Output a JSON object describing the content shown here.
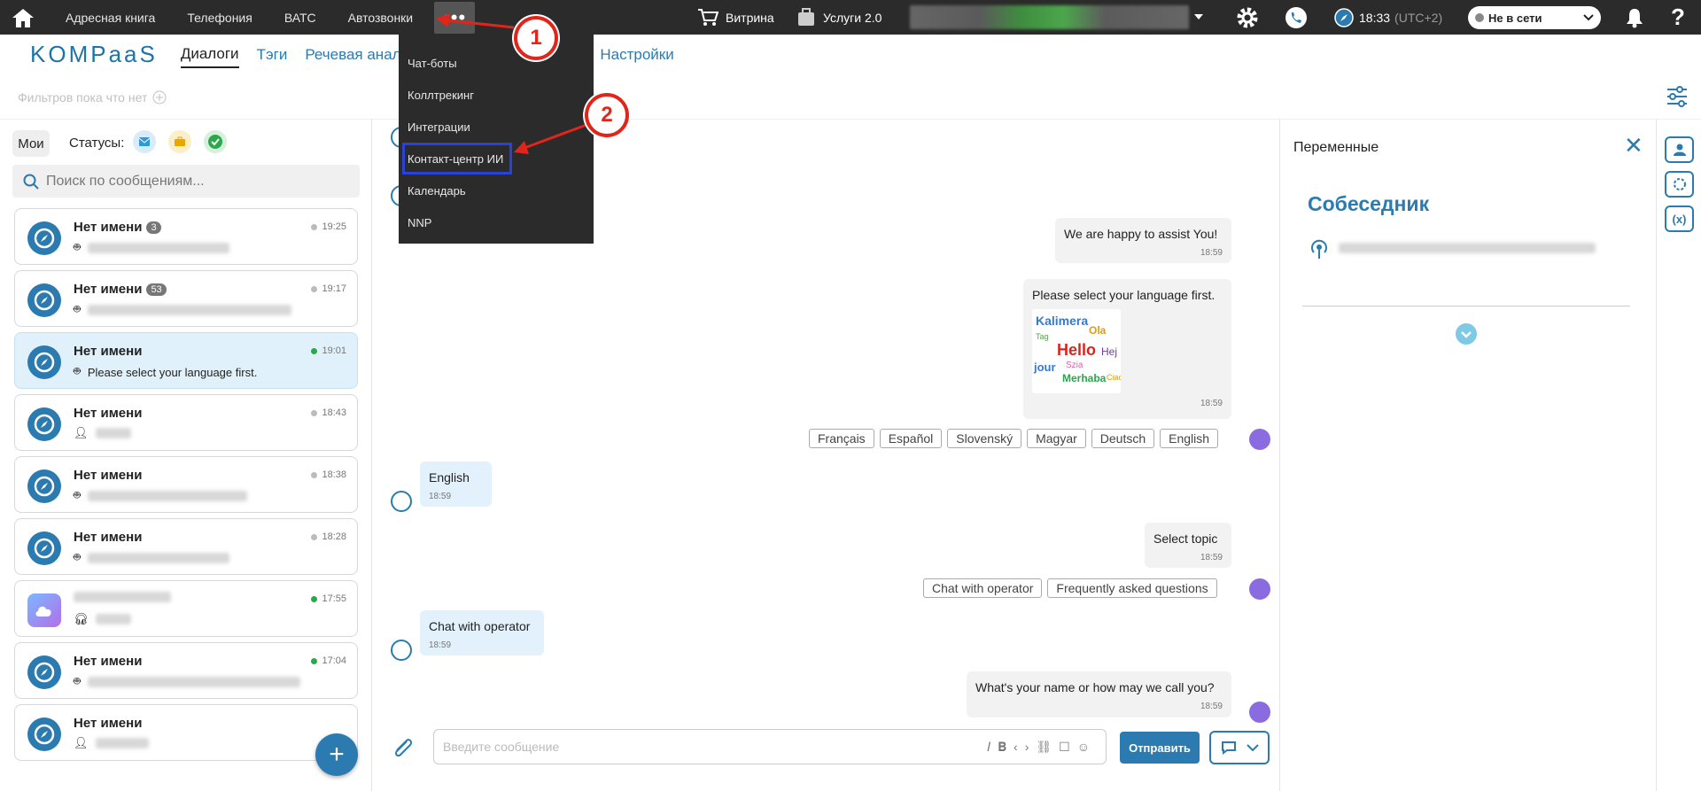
{
  "topbar": {
    "nav": [
      "Адресная книга",
      "Телефония",
      "ВАТС",
      "Автозвонки"
    ],
    "more_label": "•••",
    "showcase": "Витрина",
    "services": "Услуги 2.0",
    "clock": "18:33",
    "timezone": "(UTC+2)",
    "status": "Не в сети",
    "help": "?"
  },
  "header": {
    "logo": "KOMPaaS",
    "tabs": [
      "Диалоги",
      "Тэги",
      "Речевая аналити",
      "Настройки"
    ]
  },
  "filters": {
    "empty_text": "Фильтров пока что нет"
  },
  "sidebar": {
    "mine_label": "Мои",
    "statuses_label": "Статусы:",
    "search_placeholder": "Поиск по сообщениям...",
    "chats": [
      {
        "name": "Нет имени",
        "badge": "3",
        "time": "19:25",
        "status": "gray",
        "message": ""
      },
      {
        "name": "Нет имени",
        "badge": "53",
        "time": "19:17",
        "status": "gray",
        "message": ""
      },
      {
        "name": "Нет имени",
        "badge": "",
        "time": "19:01",
        "status": "green",
        "message": "Please select your language first."
      },
      {
        "name": "Нет имени",
        "badge": "",
        "time": "18:43",
        "status": "gray",
        "message": ""
      },
      {
        "name": "Нет имени",
        "badge": "",
        "time": "18:38",
        "status": "gray",
        "message": ""
      },
      {
        "name": "Нет имени",
        "badge": "",
        "time": "18:28",
        "status": "gray",
        "message": ""
      },
      {
        "name": "",
        "badge": "",
        "time": "17:55",
        "status": "green",
        "message": ""
      },
      {
        "name": "Нет имени",
        "badge": "",
        "time": "17:04",
        "status": "green",
        "message": ""
      },
      {
        "name": "Нет имени",
        "badge": "",
        "time": "",
        "status": "blue",
        "message": ""
      }
    ],
    "fab": "+"
  },
  "chat": {
    "m1": {
      "text": "We are happy to assist You!",
      "time": "18:59"
    },
    "m2": {
      "text": "Please select your language first.",
      "time": "18:59"
    },
    "lang_buttons": [
      "Français",
      "Español",
      "Slovenský",
      "Magyar",
      "Deutsch",
      "English"
    ],
    "c1": {
      "text": "English",
      "time": "18:59"
    },
    "m3": {
      "text": "Select topic",
      "time": "18:59"
    },
    "topic_buttons": [
      "Chat with operator",
      "Frequently asked questions"
    ],
    "c2": {
      "text": "Chat with operator",
      "time": "18:59"
    },
    "m4": {
      "text": "What's your name or how may we call you?",
      "time": "18:59"
    },
    "composer_placeholder": "Введите сообщение",
    "send_label": "Отправить"
  },
  "variables": {
    "title": "Переменные",
    "subtitle": "Собеседник"
  },
  "dropdown": {
    "items": [
      "Чат-боты",
      "Коллтрекинг",
      "Интеграции",
      "Контакт-центр ИИ",
      "Календарь",
      "NNP"
    ]
  },
  "callouts": [
    "1",
    "2"
  ],
  "colors": {
    "accent": "#2b7bb0",
    "topbar": "#2b2b2b",
    "callout": "#e1251b",
    "highlight": "#2a42d6"
  }
}
